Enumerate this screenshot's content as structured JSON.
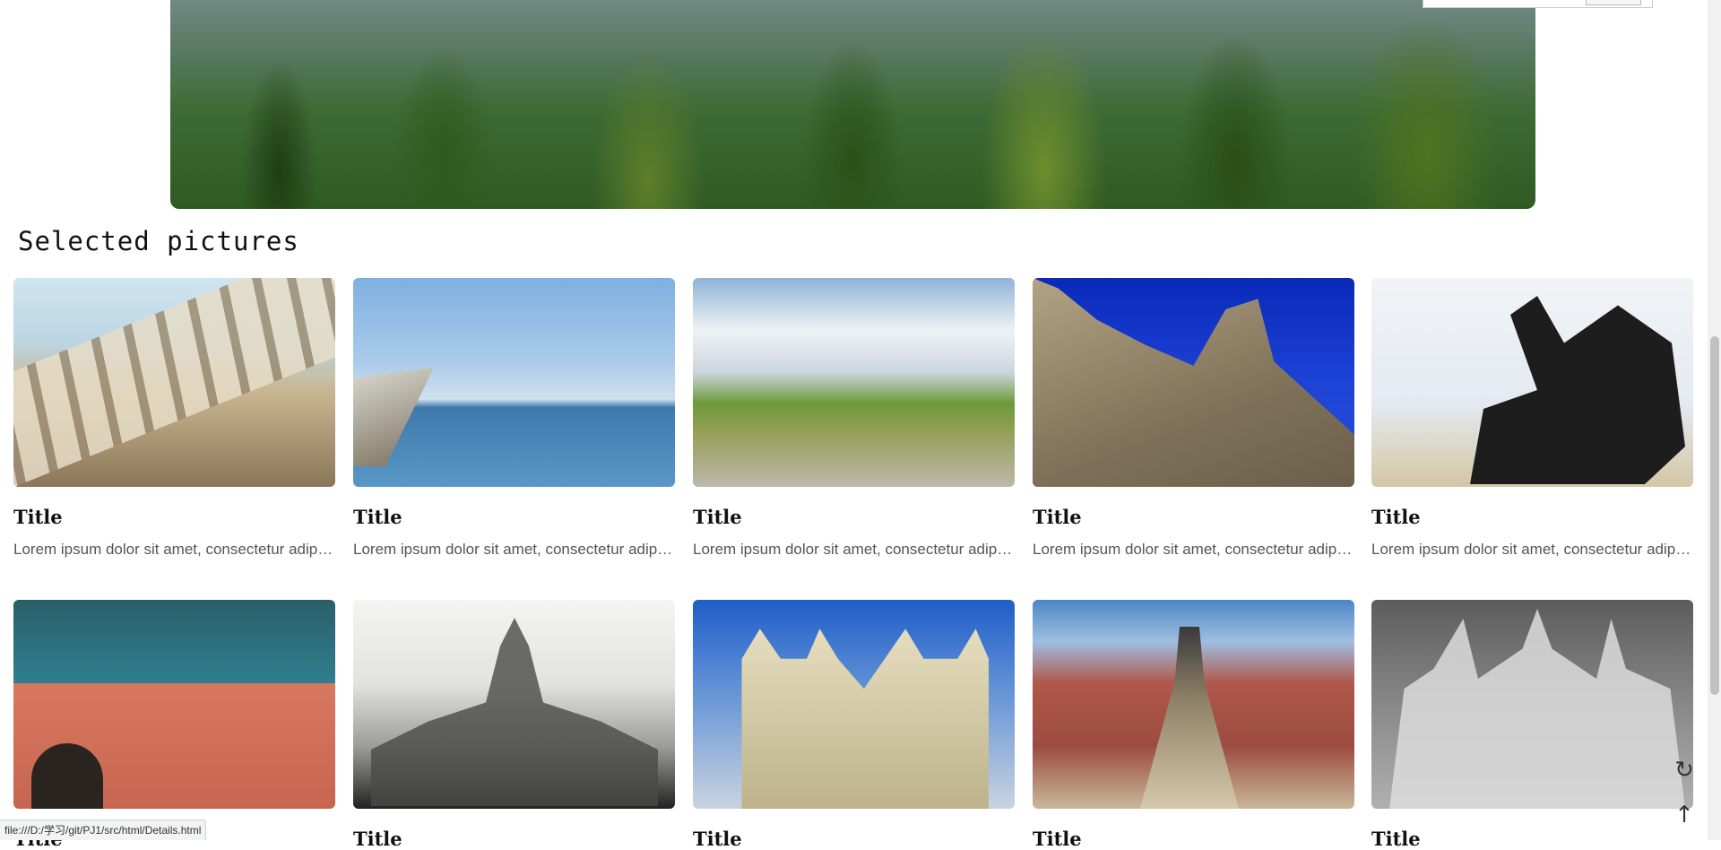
{
  "section": {
    "title": "Selected pictures"
  },
  "cards": [
    {
      "title": "Title",
      "desc": "Lorem ipsum dolor sit amet, consectetur adipiscing elit"
    },
    {
      "title": "Title",
      "desc": "Lorem ipsum dolor sit amet, consectetur adipiscing elit"
    },
    {
      "title": "Title",
      "desc": "Lorem ipsum dolor sit amet, consectetur adipiscing elit"
    },
    {
      "title": "Title",
      "desc": "Lorem ipsum dolor sit amet, consectetur adipiscing elit"
    },
    {
      "title": "Title",
      "desc": "Lorem ipsum dolor sit amet, consectetur adipiscing elit"
    },
    {
      "title": "Title",
      "desc": ""
    },
    {
      "title": "Title",
      "desc": ""
    },
    {
      "title": "Title",
      "desc": ""
    },
    {
      "title": "Title",
      "desc": ""
    },
    {
      "title": "Title",
      "desc": ""
    }
  ],
  "images": [
    "stadium-santiago-bernabeu",
    "boat-bow-sea",
    "rocky-grassland-clouds",
    "castle-tower-blue-sky",
    "horse-statue",
    "arsenal-stadium",
    "palace-building-bw",
    "westminster-abbey",
    "royal-albert-hall",
    "milan-cathedral-bw"
  ],
  "statusbar": {
    "url": "file:///D:/学习/git/PJ1/src/html/Details.html"
  },
  "controls": {
    "refresh_icon": "refresh-icon",
    "back_to_top_icon": "arrow-up-icon"
  }
}
